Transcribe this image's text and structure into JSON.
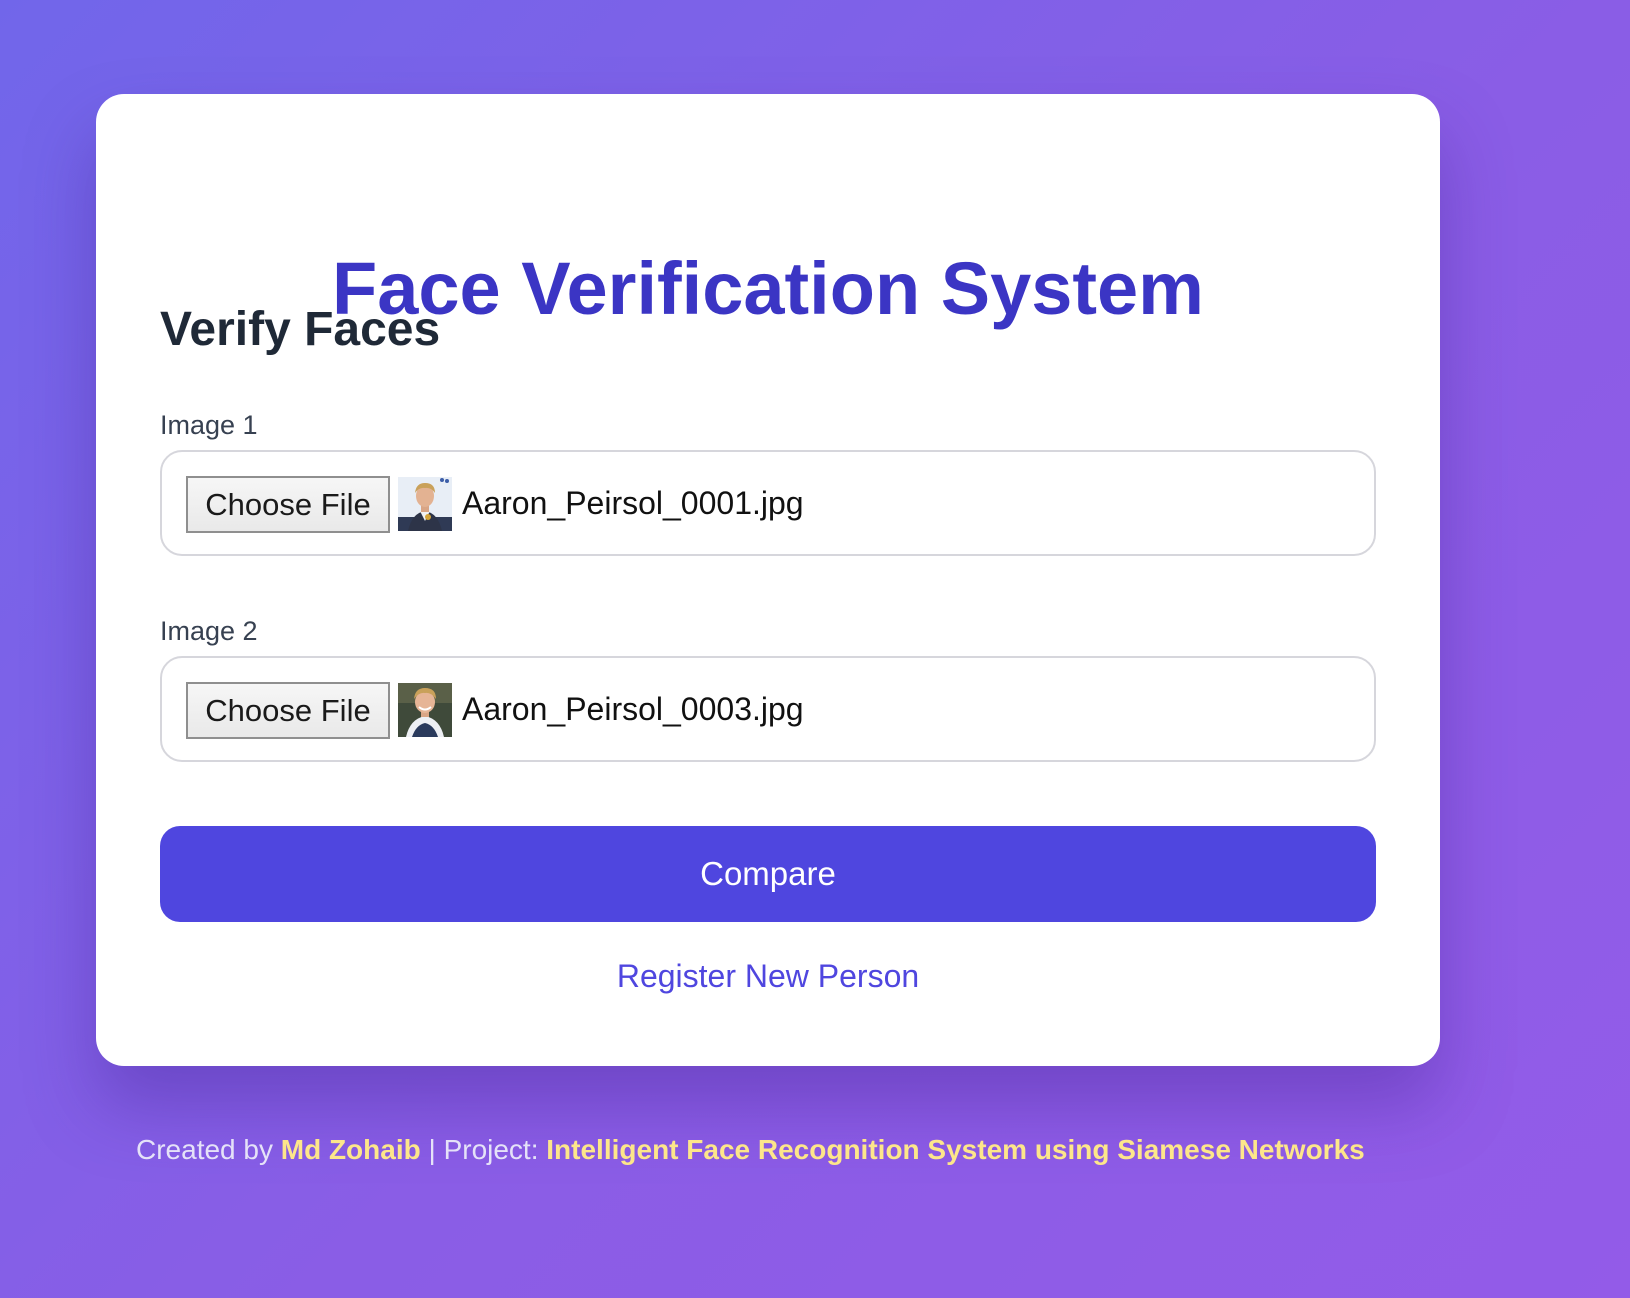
{
  "app": {
    "title": "Face Verification System"
  },
  "verify": {
    "heading": "Verify Faces",
    "image1": {
      "label": "Image 1",
      "button_label": "Choose File",
      "file_name": "Aaron_Peirsol_0001.jpg"
    },
    "image2": {
      "label": "Image 2",
      "button_label": "Choose File",
      "file_name": "Aaron_Peirsol_0003.jpg"
    },
    "compare_label": "Compare",
    "register_link": "Register New Person"
  },
  "footer": {
    "created_by_prefix": "Created by ",
    "author": "Md Zohaib",
    "project_prefix": " | Project: ",
    "project": "Intelligent Face Recognition System using Siamese Networks"
  },
  "colors": {
    "accent": "#4f46df",
    "title": "#3b35c4",
    "footer_highlight": "#fde68a",
    "background_start": "#7166ea",
    "background_end": "#935be8"
  }
}
